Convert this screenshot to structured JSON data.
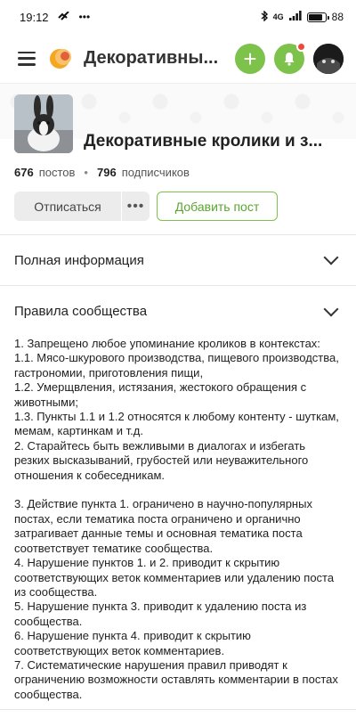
{
  "status_bar": {
    "time": "19:12",
    "icons": [
      "signal-glyph-icon",
      "more-dots-icon"
    ],
    "network": "4G",
    "battery_level": 0.88,
    "battery_text": "88"
  },
  "header": {
    "title": "Декоративны...",
    "accent_color": "#7cc24b",
    "notification_dot_color": "#f0483e"
  },
  "community": {
    "title": "Декоративные кролики и з...",
    "posts_count": "676",
    "posts_label": "постов",
    "subscribers_count": "796",
    "subscribers_label": "подписчиков",
    "unsubscribe_label": "Отписаться",
    "more_label": "•••",
    "add_post_label": "Добавить пост"
  },
  "sections": {
    "full_info": "Полная информация",
    "rules_title": "Правила сообщества",
    "rules_text": "1. Запрещено любое упоминание кроликов в контекстах:\n1.1. Мясо-шкурового производства, пищевого производства, гастрономии, приготовления пищи,\n1.2. Умерщвления, истязания, жестокого обращения с животными;\n1.3. Пункты 1.1 и 1.2 относятся к любому контенту - шуткам, мемам, картинкам и т.д.\n2. Старайтесь быть вежливыми в диалогах и избегать резких высказываний, грубостей или неуважительного отношения к собеседникам.\n\n3. Действие пункта 1. ограничено в научно-популярных постах, если тематика поста ограничено и органично затрагивает данные темы и основная тематика поста соответствует тематике сообщества.\n4. Нарушение пунктов 1. и 2. приводит к скрытию соответствующих веток комментариев или удалению поста из сообщества.\n5. Нарушение пункта 3. приводит к удалению поста из сообщества.\n6. Нарушение пункта 4. приводит к скрытию соответствующих веток комментариев.\n7. Систематические нарушения правил приводят к ограничению возможности оставлять комментарии в постах сообщества."
  }
}
